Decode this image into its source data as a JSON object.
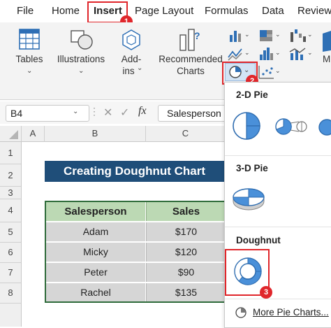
{
  "menu": {
    "tabs": [
      "File",
      "Home",
      "Insert",
      "Page Layout",
      "Formulas",
      "Data",
      "Review"
    ],
    "active": "Insert"
  },
  "ribbon": {
    "tables_label": "Tables",
    "illustrations_label": "Illustrations",
    "addins_label_1": "Add-",
    "addins_label_2": "ins",
    "recommended_label_1": "Recommended",
    "recommended_label_2": "Charts",
    "maps_partial_label": "M"
  },
  "formula_bar": {
    "name_box": "B4",
    "fx": "fx",
    "content": "Salesperson"
  },
  "grid": {
    "columns": [
      "A",
      "B",
      "C"
    ],
    "rows": [
      "1",
      "2",
      "3",
      "4",
      "5",
      "6",
      "7",
      "8"
    ],
    "title": "Creating Doughnut Chart",
    "headers": [
      "Salesperson",
      "Sales"
    ],
    "data": [
      [
        "Adam",
        "$170"
      ],
      [
        "Micky",
        "$120"
      ],
      [
        "Peter",
        "$90"
      ],
      [
        "Rachel",
        "$135"
      ]
    ]
  },
  "dropdown": {
    "section_2d": "2-D Pie",
    "section_3d": "3-D Pie",
    "section_doughnut": "Doughnut",
    "more_link": "More Pie Charts..."
  },
  "badges": [
    "1",
    "2",
    "3"
  ],
  "colors": {
    "accent_red": "#e0262b",
    "title_bg": "#1f4e79",
    "header_bg": "#bcd9b4",
    "data_bg": "#d6d6d6",
    "table_border": "#2e6b3a",
    "chart_blue": "#4a90d9"
  }
}
